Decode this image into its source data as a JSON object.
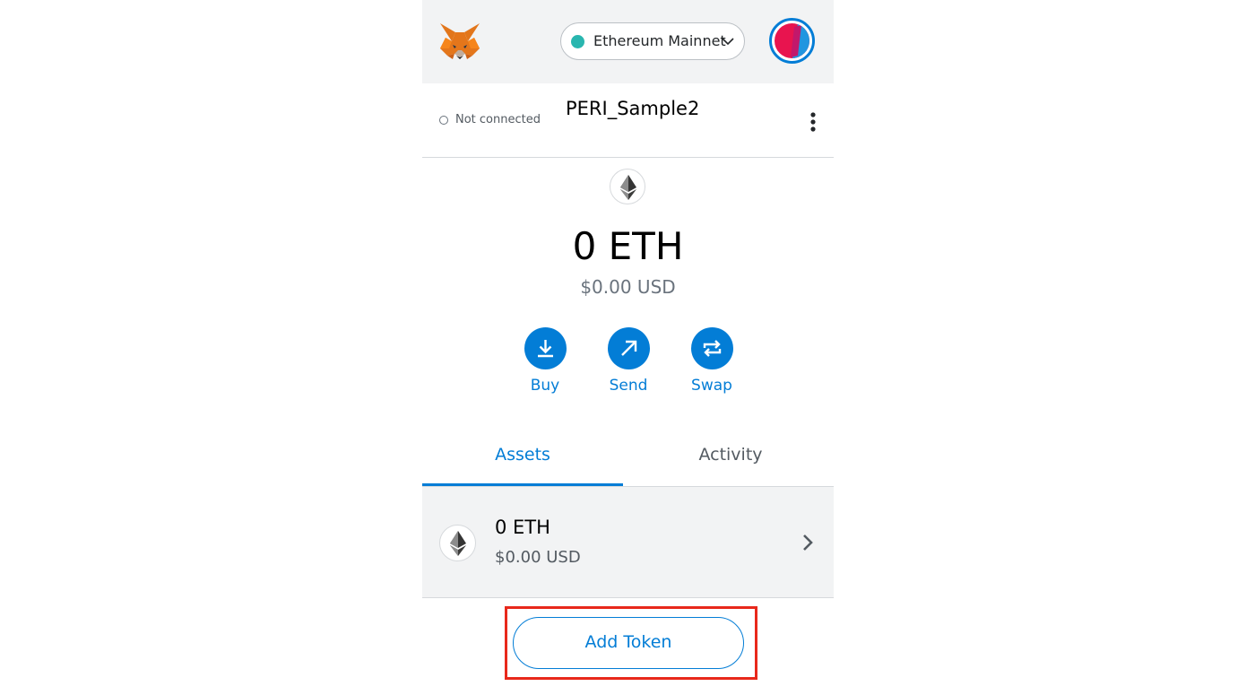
{
  "header": {
    "logo_icon": "metamask-fox-icon",
    "network": {
      "label": "Ethereum Mainnet",
      "dot_color": "#29b6af"
    },
    "account_avatar_icon": "account-identicon"
  },
  "account_bar": {
    "connection_status": "Not connected",
    "account_name": "PERI_Sample2",
    "menu_icon": "kebab-menu-icon"
  },
  "balance": {
    "primary": "0 ETH",
    "secondary": "$0.00 USD"
  },
  "actions": [
    {
      "label": "Buy",
      "icon": "download-icon"
    },
    {
      "label": "Send",
      "icon": "arrow-up-right-icon"
    },
    {
      "label": "Swap",
      "icon": "swap-icon"
    }
  ],
  "tabs": [
    {
      "label": "Assets",
      "active": true
    },
    {
      "label": "Activity",
      "active": false
    }
  ],
  "assets": [
    {
      "amount": "0 ETH",
      "usd": "$0.00 USD",
      "icon": "ethereum-icon"
    }
  ],
  "add_token_label": "Add Token",
  "colors": {
    "accent": "#037dd6",
    "highlight": "#e8281b",
    "header_bg": "#f2f3f4"
  }
}
